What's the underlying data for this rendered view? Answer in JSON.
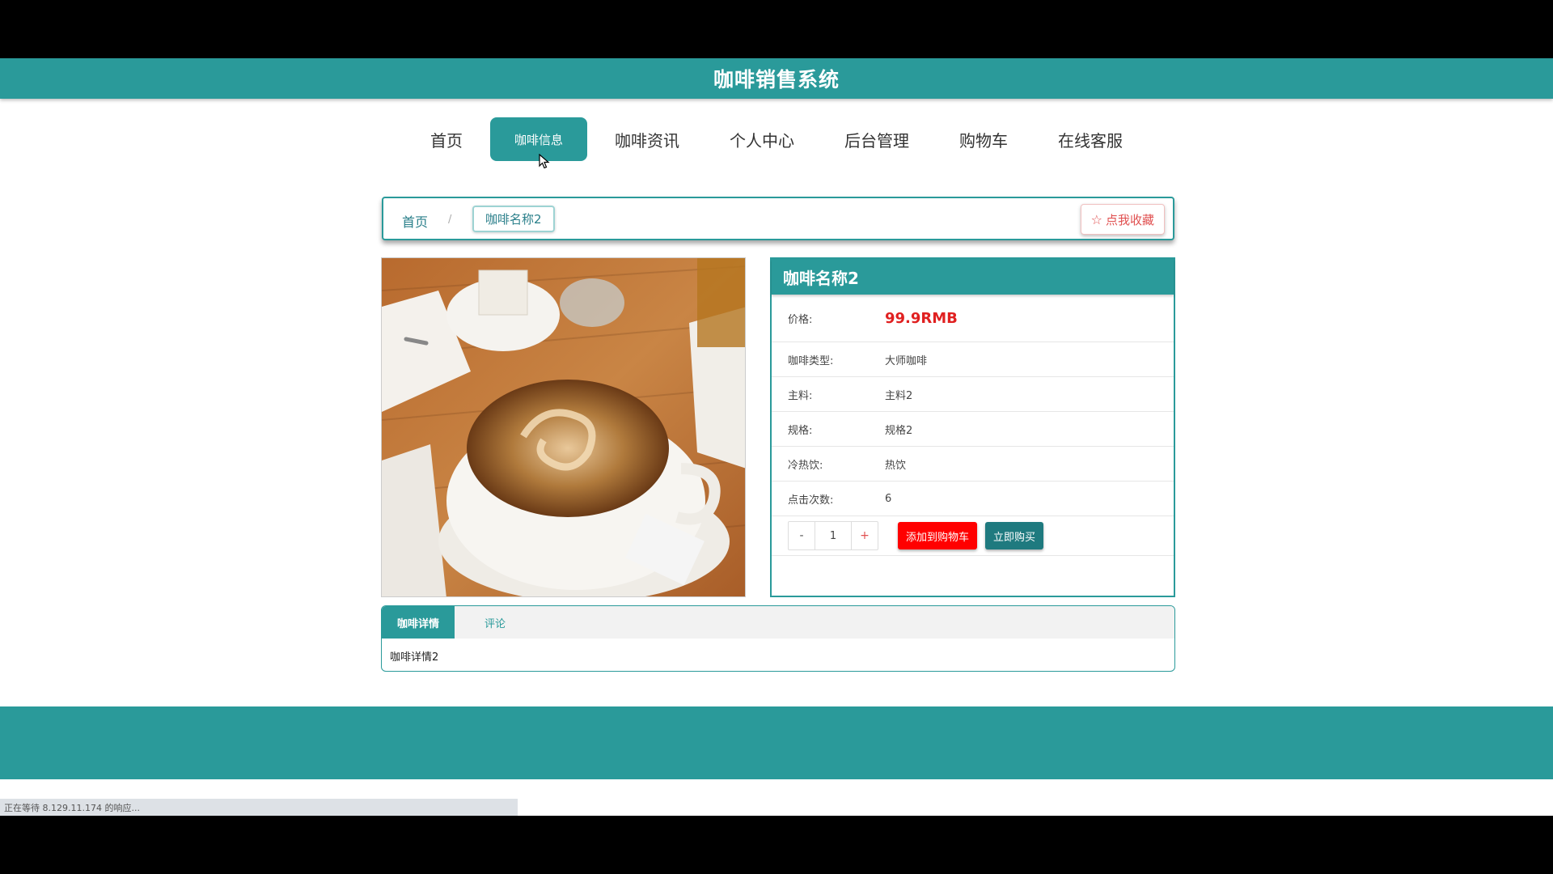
{
  "header": {
    "title": "咖啡销售系统"
  },
  "nav": {
    "items": [
      "首页",
      "咖啡信息",
      "咖啡资讯",
      "个人中心",
      "后台管理",
      "购物车",
      "在线客服"
    ],
    "active_index": 1
  },
  "breadcrumb": {
    "home": "首页",
    "separator": "/",
    "current": "咖啡名称2"
  },
  "favorite_button": {
    "icon": "star-outline-icon",
    "label": "点我收藏"
  },
  "product": {
    "name": "咖啡名称2",
    "price_label": "价格:",
    "price": "99.9RMB",
    "attributes": [
      {
        "label": "咖啡类型:",
        "value": "大师咖啡"
      },
      {
        "label": "主料:",
        "value": "主料2"
      },
      {
        "label": "规格:",
        "value": "规格2"
      },
      {
        "label": "冷热饮:",
        "value": "热饮"
      },
      {
        "label": "点击次数:",
        "value": "6"
      }
    ],
    "quantity": {
      "minus": "-",
      "value": "1",
      "plus": "+"
    },
    "add_to_cart": "添加到购物车",
    "buy_now": "立即购买"
  },
  "tabs": {
    "items": [
      "咖啡详情",
      "评论"
    ],
    "active_index": 0,
    "content": "咖啡详情2"
  },
  "status_bar": {
    "text": "正在等待 8.129.11.174 的响应..."
  },
  "colors": {
    "primary": "#2a9a9a",
    "price": "#e02020",
    "cart_button": "#ff0000",
    "buy_button": "#1f7a7f"
  }
}
